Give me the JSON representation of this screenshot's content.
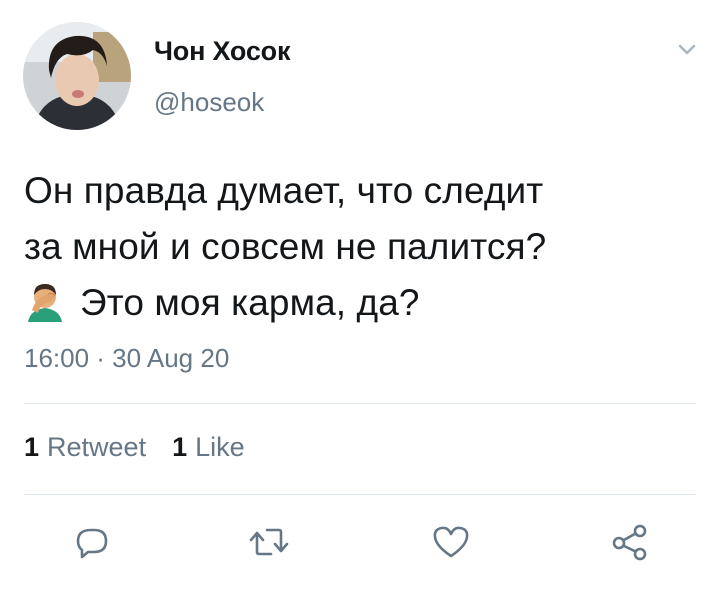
{
  "author": {
    "name": "Чон Хосок",
    "handle": "@hoseok"
  },
  "tweet": {
    "lines": [
      "Он правда думает, что следит",
      "за мной и совсем не палится?",
      "Это моя карма, да?"
    ],
    "emoji": "face-palm-emoji",
    "timestamp": "16:00 · 30 Aug 20"
  },
  "stats": {
    "retweet_count": "1",
    "retweet_label": "Retweet",
    "like_count": "1",
    "like_label": "Like"
  },
  "actions": [
    "reply-icon",
    "retweet-icon",
    "like-icon",
    "share-icon"
  ],
  "colors": {
    "text": "#14171a",
    "secondary": "#657786",
    "icon": "#657786",
    "divider": "#e1e8ed"
  }
}
